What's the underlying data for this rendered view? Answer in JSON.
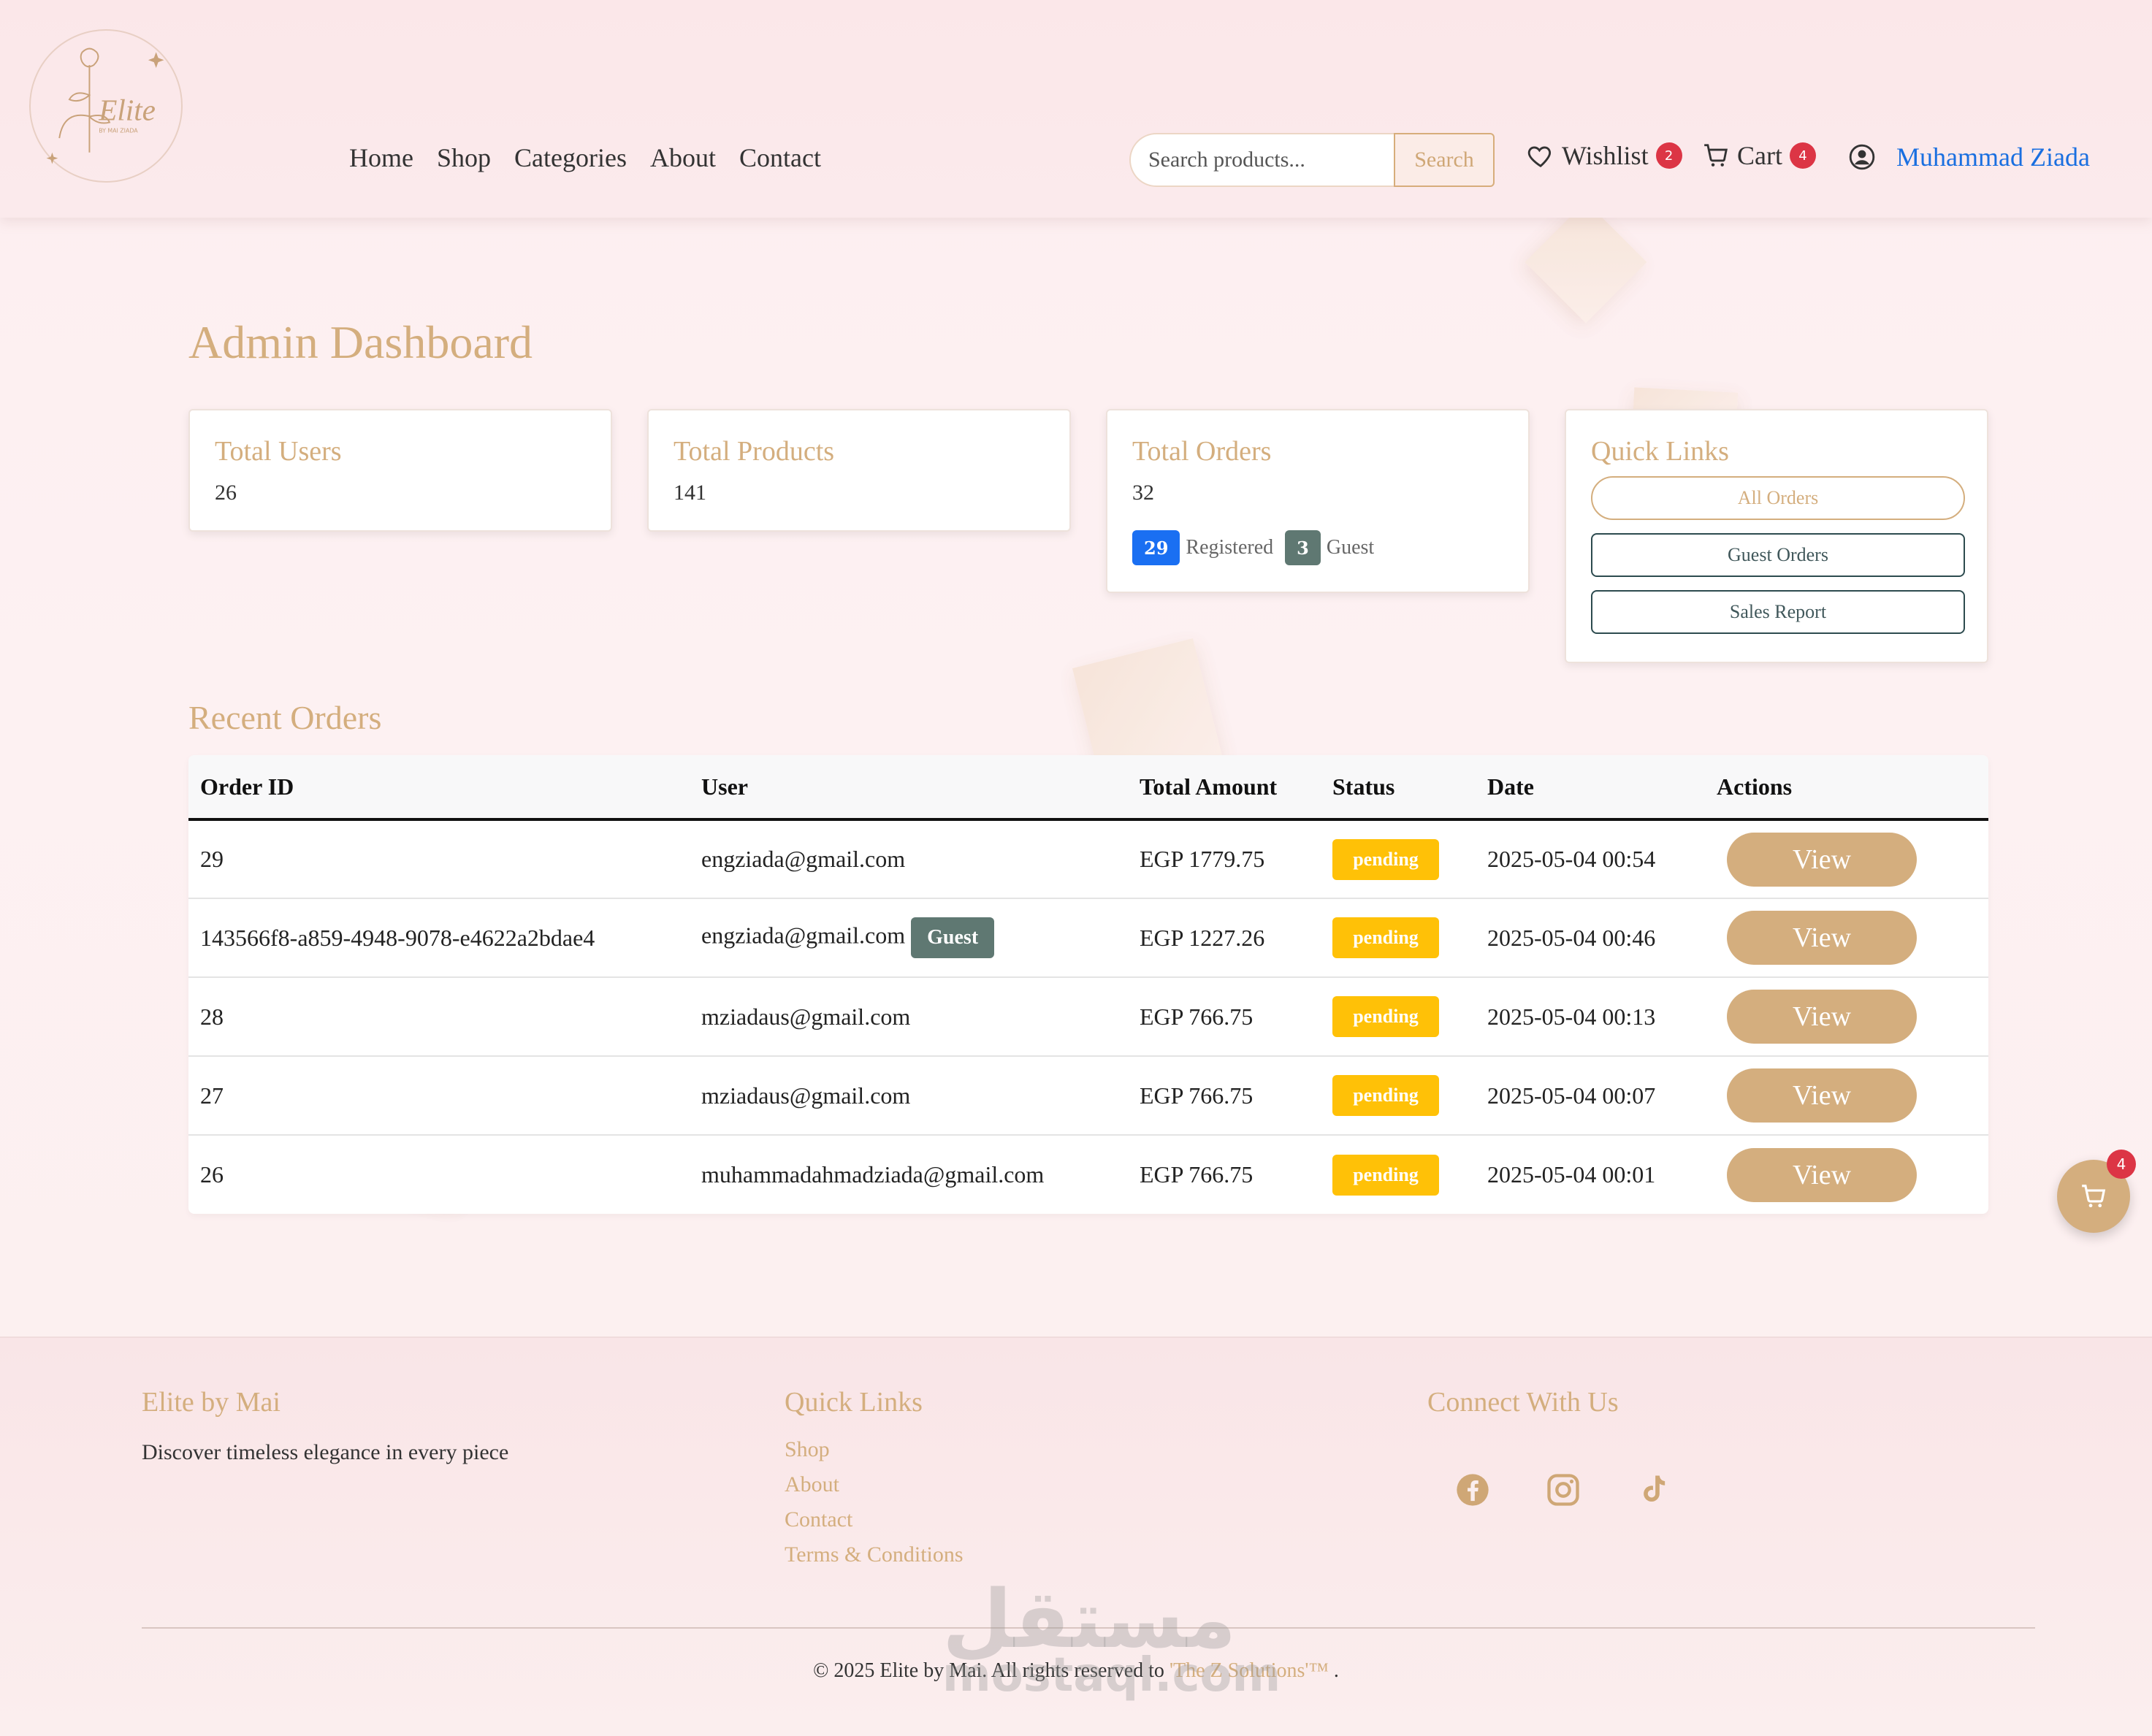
{
  "brand": {
    "logo_text": "Elite",
    "logo_subtext": "BY MAI ZIADA"
  },
  "nav": {
    "items": [
      {
        "label": "Home"
      },
      {
        "label": "Shop"
      },
      {
        "label": "Categories"
      },
      {
        "label": "About"
      },
      {
        "label": "Contact"
      }
    ]
  },
  "search": {
    "placeholder": "Search products...",
    "value": "",
    "button_label": "Search"
  },
  "header": {
    "wishlist_label": "Wishlist",
    "wishlist_count": "2",
    "cart_label": "Cart",
    "cart_count": "4",
    "user_name": "Muhammad Ziada"
  },
  "dashboard": {
    "title": "Admin Dashboard",
    "cards": {
      "users": {
        "title": "Total Users",
        "value": "26"
      },
      "products": {
        "title": "Total Products",
        "value": "141"
      },
      "orders": {
        "title": "Total Orders",
        "value": "32",
        "registered_count": "29",
        "registered_label": "Registered",
        "guest_count": "3",
        "guest_label": "Guest"
      },
      "quick_links": {
        "title": "Quick Links",
        "buttons": [
          {
            "label": "All Orders"
          },
          {
            "label": "Guest Orders"
          },
          {
            "label": "Sales Report"
          }
        ]
      }
    }
  },
  "recent_orders": {
    "title": "Recent Orders",
    "columns": [
      "Order ID",
      "User",
      "Total Amount",
      "Status",
      "Date",
      "Actions"
    ],
    "rows": [
      {
        "id": "29",
        "user": "engziada@gmail.com",
        "guest": "",
        "amount": "EGP 1779.75",
        "status": "pending",
        "date": "2025-05-04 00:54",
        "action": "View"
      },
      {
        "id": "143566f8-a859-4948-9078-e4622a2bdae4",
        "user": "engziada@gmail.com",
        "guest": "Guest",
        "amount": "EGP 1227.26",
        "status": "pending",
        "date": "2025-05-04 00:46",
        "action": "View"
      },
      {
        "id": "28",
        "user": "mziadaus@gmail.com",
        "guest": "",
        "amount": "EGP 766.75",
        "status": "pending",
        "date": "2025-05-04 00:13",
        "action": "View"
      },
      {
        "id": "27",
        "user": "mziadaus@gmail.com",
        "guest": "",
        "amount": "EGP 766.75",
        "status": "pending",
        "date": "2025-05-04 00:07",
        "action": "View"
      },
      {
        "id": "26",
        "user": "muhammadahmadziada@gmail.com",
        "guest": "",
        "amount": "EGP 766.75",
        "status": "pending",
        "date": "2025-05-04 00:01",
        "action": "View"
      }
    ]
  },
  "floating_cart": {
    "count": "4"
  },
  "footer": {
    "brand_title": "Elite by Mai",
    "tagline": "Discover timeless elegance in every piece",
    "quick_links_title": "Quick Links",
    "quick_links": [
      {
        "label": "Shop"
      },
      {
        "label": "About"
      },
      {
        "label": "Contact"
      },
      {
        "label": "Terms & Conditions"
      }
    ],
    "connect_title": "Connect With Us",
    "social_icons": [
      "facebook-icon",
      "instagram-icon",
      "tiktok-icon"
    ],
    "copyright_prefix": "© 2025 Elite by Mai. All rights reserved to",
    "copyright_link": "'The Z Solutions'™",
    "copyright_suffix": "."
  },
  "watermark": {
    "arabic": "مستقل",
    "latin": "mostaql.com"
  },
  "colors": {
    "accent": "#d4ae7e",
    "link_blue": "#1a6fe0",
    "badge_red": "#dc3545",
    "status_pending": "#ffc107",
    "guest_gray": "#5f7872",
    "registered_blue": "#1a6ff2"
  }
}
